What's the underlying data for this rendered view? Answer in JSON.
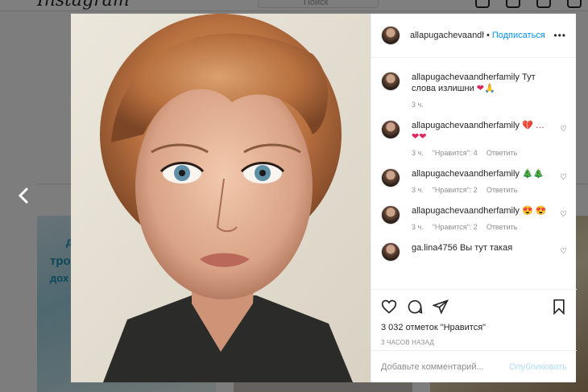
{
  "app": {
    "logo": "Instagram",
    "search_placeholder": "Поиск"
  },
  "post": {
    "username": "allapugachevaandh",
    "separator": "•",
    "follow_label": "Подписаться",
    "more_icon": "more-horizontal-icon",
    "comments": [
      {
        "user": "allapugachevaandherfamily",
        "text": "Тут слова излишни",
        "emoji": "❤🙏",
        "time": "3 ч.",
        "likes": "",
        "reply": ""
      },
      {
        "user": "allapugachevaandherfamily",
        "text": "",
        "emoji": "💔 … ❤❤",
        "time": "3 ч.",
        "likes": "\"Нравится\": 4",
        "reply": "Ответить"
      },
      {
        "user": "allapugachevaandherfamily",
        "text": "",
        "emoji": "🎄🎄",
        "time": "3 ч.",
        "likes": "\"Нравится\": 2",
        "reply": "Ответить"
      },
      {
        "user": "allapugachevaandherfamily",
        "text": "",
        "emoji": "😍 😍",
        "time": "3 ч.",
        "likes": "\"Нравится\": 2",
        "reply": "Ответить"
      },
      {
        "user": "ga.lina4756",
        "text": "Вы тут такая",
        "emoji": "",
        "time": "",
        "likes": "",
        "reply": ""
      }
    ],
    "likes_text": "3 032 отметок \"Нравится\"",
    "time_ago": "3 ЧАСОВ НАЗАД",
    "comment_placeholder": "Добавьте комментарий...",
    "publish_label": "Опубликовать"
  },
  "background_tiles": {
    "tile1_words": [
      "д",
      "тро",
      "дох"
    ]
  },
  "colors": {
    "accent": "#0095f6",
    "heart": "#e0245e",
    "overlay": "rgba(0,0,0,0.5)"
  }
}
